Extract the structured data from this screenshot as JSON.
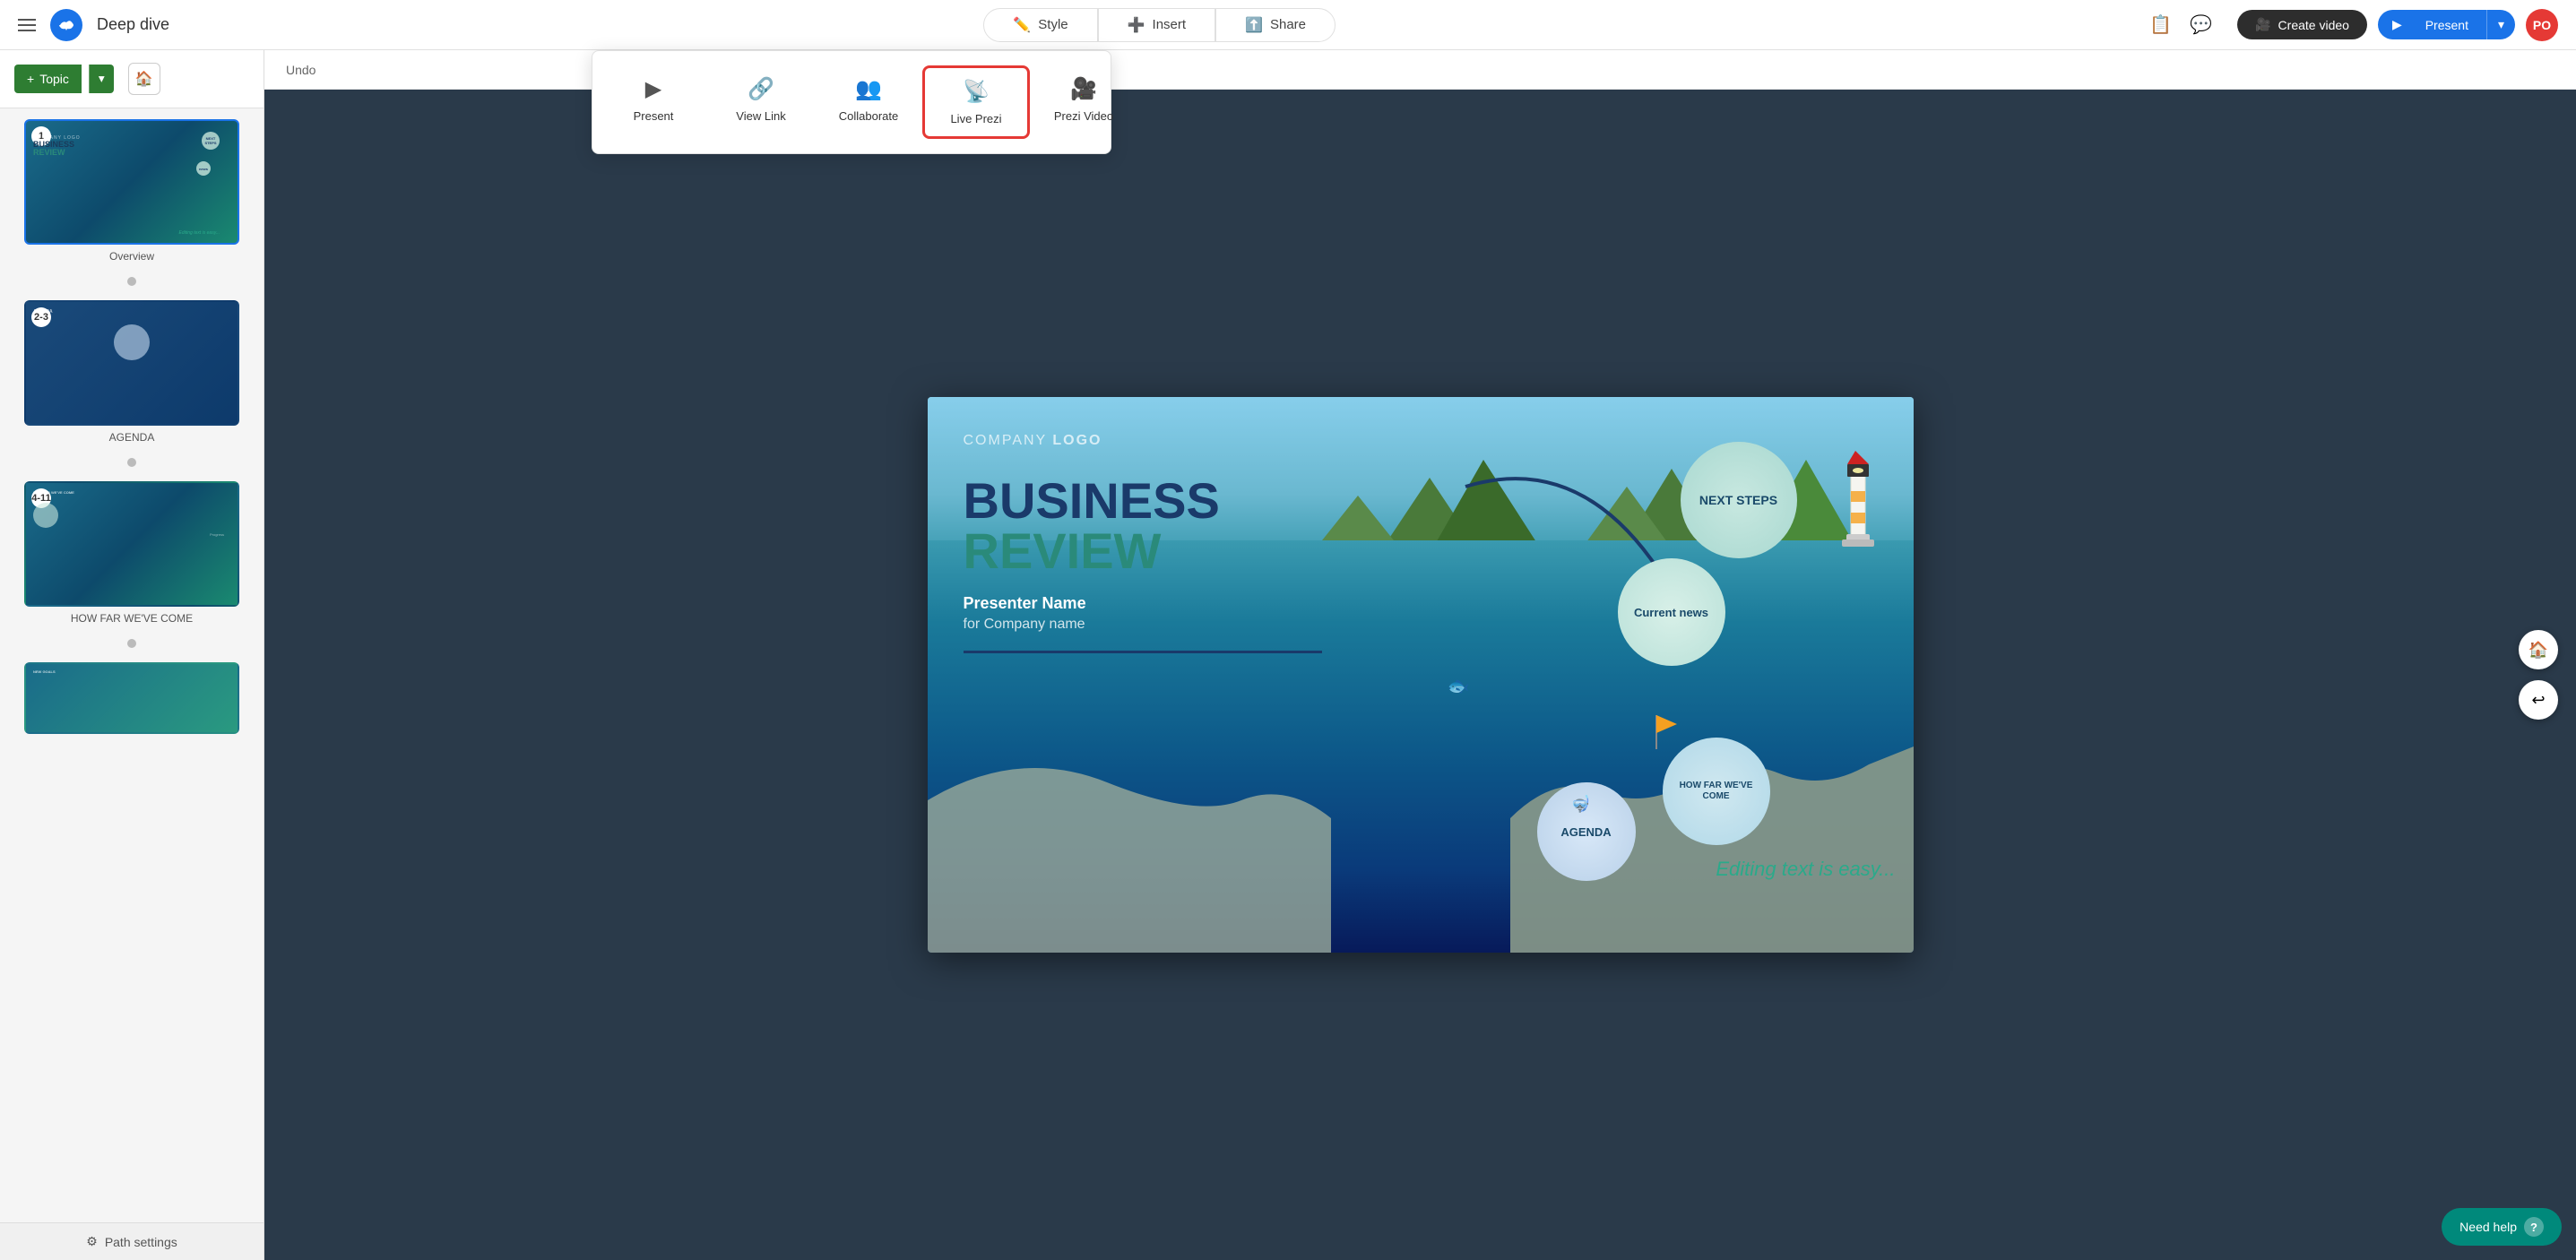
{
  "app": {
    "title": "Deep dive",
    "cloud_icon_label": "prezi-cloud"
  },
  "topbar": {
    "style_label": "Style",
    "insert_label": "Insert",
    "share_label": "Share",
    "create_video_label": "Create video",
    "present_label": "Present",
    "avatar_initials": "PO"
  },
  "undo_bar": {
    "undo_label": "Undo"
  },
  "share_dropdown": {
    "present_label": "Present",
    "view_link_label": "View Link",
    "collaborate_label": "Collaborate",
    "live_prezi_label": "Live Prezi",
    "prezi_video_label": "Prezi Video"
  },
  "sidebar": {
    "topic_label": "Topic",
    "home_label": "🏠",
    "items": [
      {
        "id": "overview",
        "number": "1",
        "label": "Overview",
        "active": true
      },
      {
        "id": "agenda",
        "number": "2-3",
        "label": "AGENDA",
        "active": false
      },
      {
        "id": "how-far",
        "number": "4-11",
        "label": "HOW FAR WE'VE COME",
        "active": false
      },
      {
        "id": "new-goals",
        "number": "",
        "label": "",
        "active": false
      }
    ],
    "path_settings_label": "Path settings"
  },
  "slide": {
    "company_logo": "COMPANY LOGO",
    "title_line1": "BUSINESS",
    "title_line2": "REVIEW",
    "presenter_name": "Presenter Name",
    "presenter_sub": "for Company name",
    "circles": {
      "next_steps": "NEXT STEPS",
      "current_news": "Current news",
      "how_far_we_came": "HOW FAR WE'VE COME",
      "agenda": "AGENDA"
    },
    "editing_text": "Editing text is easy..."
  },
  "right_nav": {
    "home_label": "🏠",
    "undo_label": "↩"
  },
  "need_help": {
    "label": "Need help",
    "icon": "?"
  }
}
